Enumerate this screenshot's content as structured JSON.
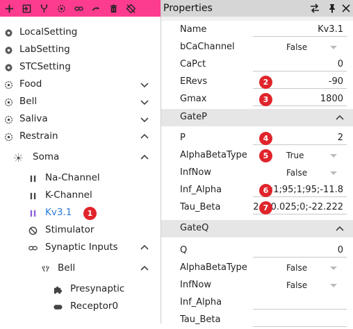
{
  "toolbar": {
    "icons": [
      "plus-icon",
      "import-icon",
      "branch-icon",
      "target-icon",
      "link-icon",
      "redo-icon",
      "trash-icon",
      "disable-icon"
    ]
  },
  "tree": {
    "items": [
      {
        "label": "LocalSetting",
        "icon": "gear-icon"
      },
      {
        "label": "LabSetting",
        "icon": "gear-icon"
      },
      {
        "label": "STCSetting",
        "icon": "gear-icon"
      },
      {
        "label": "Food",
        "icon": "dotted-circle-icon",
        "chev": "down"
      },
      {
        "label": "Bell",
        "icon": "dotted-circle-icon",
        "chev": "down"
      },
      {
        "label": "Saliva",
        "icon": "dotted-circle-icon",
        "chev": "down"
      },
      {
        "label": "Restrain",
        "icon": "dotted-circle-icon",
        "chev": "up"
      },
      {
        "label": "Soma",
        "icon": "soma-icon",
        "chev": "up"
      },
      {
        "label": "Na-Channel",
        "icon": "pause-icon"
      },
      {
        "label": "K-Channel",
        "icon": "pause-icon"
      },
      {
        "label": "Kv3.1",
        "icon": "pause-icon",
        "selected": true
      },
      {
        "label": "Stimulator",
        "icon": "ban-icon"
      },
      {
        "label": "Synaptic Inputs",
        "icon": "link-icon",
        "chev": "up"
      },
      {
        "label": "Bell",
        "icon": "synapse-icon",
        "chev": "up"
      },
      {
        "label": "Presynaptic",
        "icon": "puzzle-icon"
      },
      {
        "label": "Receptor0",
        "icon": "toggle-icon"
      }
    ],
    "badge": "1"
  },
  "properties": {
    "title": "Properties",
    "rows_top": [
      {
        "label": "Name",
        "value": "Kv3.1"
      },
      {
        "label": "bCaChannel",
        "dropdown": "False"
      },
      {
        "label": "CaPct",
        "value": "0"
      },
      {
        "label": "ERevs",
        "value": "-90",
        "badge": "2"
      },
      {
        "label": "Gmax",
        "value": "1800",
        "badge": "3"
      }
    ],
    "gatep": {
      "title": "GateP",
      "rows": [
        {
          "label": "P",
          "value": "2",
          "badge": "4"
        },
        {
          "label": "AlphaBetaType",
          "dropdown": "True",
          "badge": "5"
        },
        {
          "label": "InfNow",
          "dropdown": "False"
        },
        {
          "label": "Inf_Alpha",
          "value": "4;1;95;1;95;-11.8",
          "badge": "6"
        },
        {
          "label": "Tau_Beta",
          "value": "2;0;0.025;0;-22.222",
          "badge": "7"
        }
      ]
    },
    "gateq": {
      "title": "GateQ",
      "rows": [
        {
          "label": "Q",
          "value": "0"
        },
        {
          "label": "AlphaBetaType",
          "dropdown": "False"
        },
        {
          "label": "InfNow",
          "dropdown": "False"
        },
        {
          "label": "Inf_Alpha",
          "value": ""
        },
        {
          "label": "Tau_Beta",
          "value": ""
        }
      ]
    }
  }
}
